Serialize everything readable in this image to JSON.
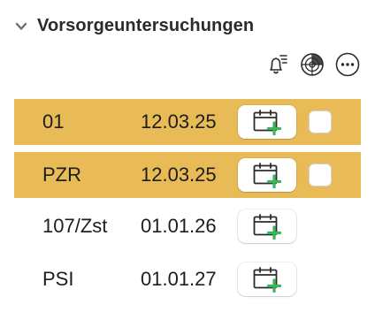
{
  "section": {
    "title": "Vorsorgeuntersuchungen",
    "collapse_icon": "chevron-down-icon"
  },
  "toolbar": {
    "icons": [
      "bell-list-icon",
      "radar-globe-icon",
      "more-ellipsis-icon"
    ]
  },
  "rows": [
    {
      "name": "01",
      "date": "12.03.25",
      "highlighted": true,
      "checked": false,
      "action_icon": "calendar-add-icon"
    },
    {
      "name": "PZR",
      "date": "12.03.25",
      "highlighted": true,
      "checked": false,
      "action_icon": "calendar-add-icon"
    },
    {
      "name": "107/Zst",
      "date": "01.01.26",
      "highlighted": false,
      "action_icon": "calendar-add-icon"
    },
    {
      "name": "PSI",
      "date": "01.01.27",
      "highlighted": false,
      "action_icon": "calendar-add-icon"
    }
  ],
  "colors": {
    "highlight": "#e8bb57",
    "plus_green": "#3cb45a",
    "text": "#1d1d1f"
  }
}
